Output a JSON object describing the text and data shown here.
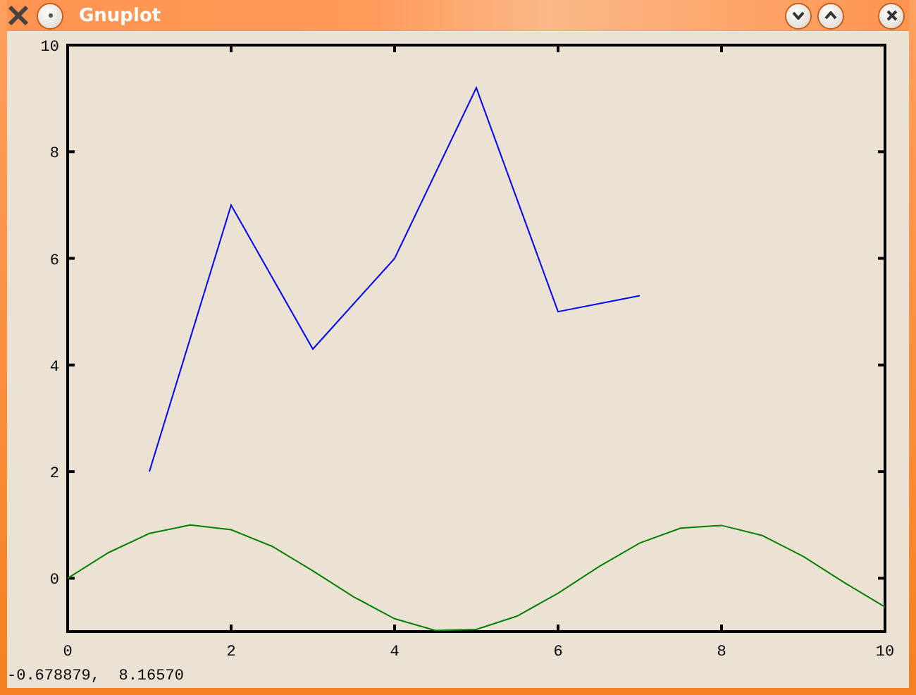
{
  "window": {
    "title": "Gnuplot"
  },
  "plot": {
    "chart_data": {
      "type": "line",
      "xlim": [
        0,
        10
      ],
      "ylim": [
        -1,
        10
      ],
      "xticks": [
        0,
        2,
        4,
        6,
        8,
        10
      ],
      "yticks": [
        0,
        2,
        4,
        6,
        8,
        10
      ],
      "series": [
        {
          "color": "#0000ff",
          "x": [
            1,
            2,
            3,
            4,
            5,
            6,
            7
          ],
          "values": [
            2,
            7,
            4.3,
            6,
            9.2,
            5,
            5.3
          ]
        },
        {
          "color": "#008000",
          "x": [
            0,
            0.5,
            1,
            1.5,
            2,
            2.5,
            3,
            3.5,
            4,
            4.5,
            5,
            5.5,
            6,
            6.5,
            7,
            7.5,
            8,
            8.5,
            9,
            9.5,
            10
          ],
          "values": [
            0,
            0.48,
            0.84,
            1.0,
            0.91,
            0.6,
            0.14,
            -0.35,
            -0.76,
            -0.98,
            -0.96,
            -0.71,
            -0.28,
            0.22,
            0.66,
            0.94,
            0.99,
            0.8,
            0.41,
            -0.08,
            -0.54
          ]
        }
      ]
    }
  },
  "status_bar": {
    "text": "-0.678879,  8.16570"
  }
}
